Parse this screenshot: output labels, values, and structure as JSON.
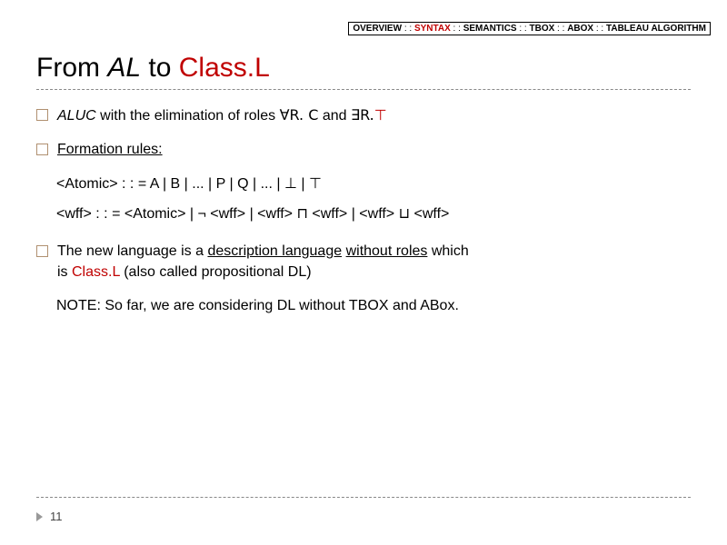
{
  "breadcrumb": {
    "items": [
      "OVERVIEW",
      "SYNTAX",
      "SEMANTICS",
      "TBOX",
      "ABOX",
      "TABLEAU ALGORITHM"
    ],
    "separator": " : : ",
    "active_index": 1
  },
  "title": {
    "prefix": "From ",
    "al_part": "AL",
    "mid": " to ",
    "classl_part": "Class.L"
  },
  "bullets": {
    "b1": {
      "aluc": "ALUC",
      "text1": " with the elimination of roles ",
      "forall": "∀R. C",
      "and": " and ",
      "exists": "∃R.",
      "top_sym": "⊤"
    },
    "b2": {
      "label": "Formation rules:"
    },
    "grammar": {
      "atomic_lhs": "<Atomic> : : = ",
      "atomic_rhs": "A | B | ... | P | Q | ... | ",
      "bot": "⊥",
      "bar_top": " | ",
      "top": "⊤",
      "wff_lhs": "<wff> : : = ",
      "wff_rhs1": "<Atomic> | ¬ <wff> | <wff> ",
      "sqcap": "⊓",
      "wff_rhs2": " <wff> | <wff> ",
      "sqcup": "⊔",
      "wff_rhs3": " <wff>"
    },
    "b3": {
      "line1a": "The new language is a ",
      "line1b_u": "description language",
      "line1c": " ",
      "line1d_u": "without roles",
      "line1e": " which",
      "line2a": "is ",
      "line2b_red": "Class.L",
      "line2c": " (also called propositional DL)"
    },
    "note": "NOTE: So far, we are considering DL without TBOX and ABox."
  },
  "page_number": "11"
}
